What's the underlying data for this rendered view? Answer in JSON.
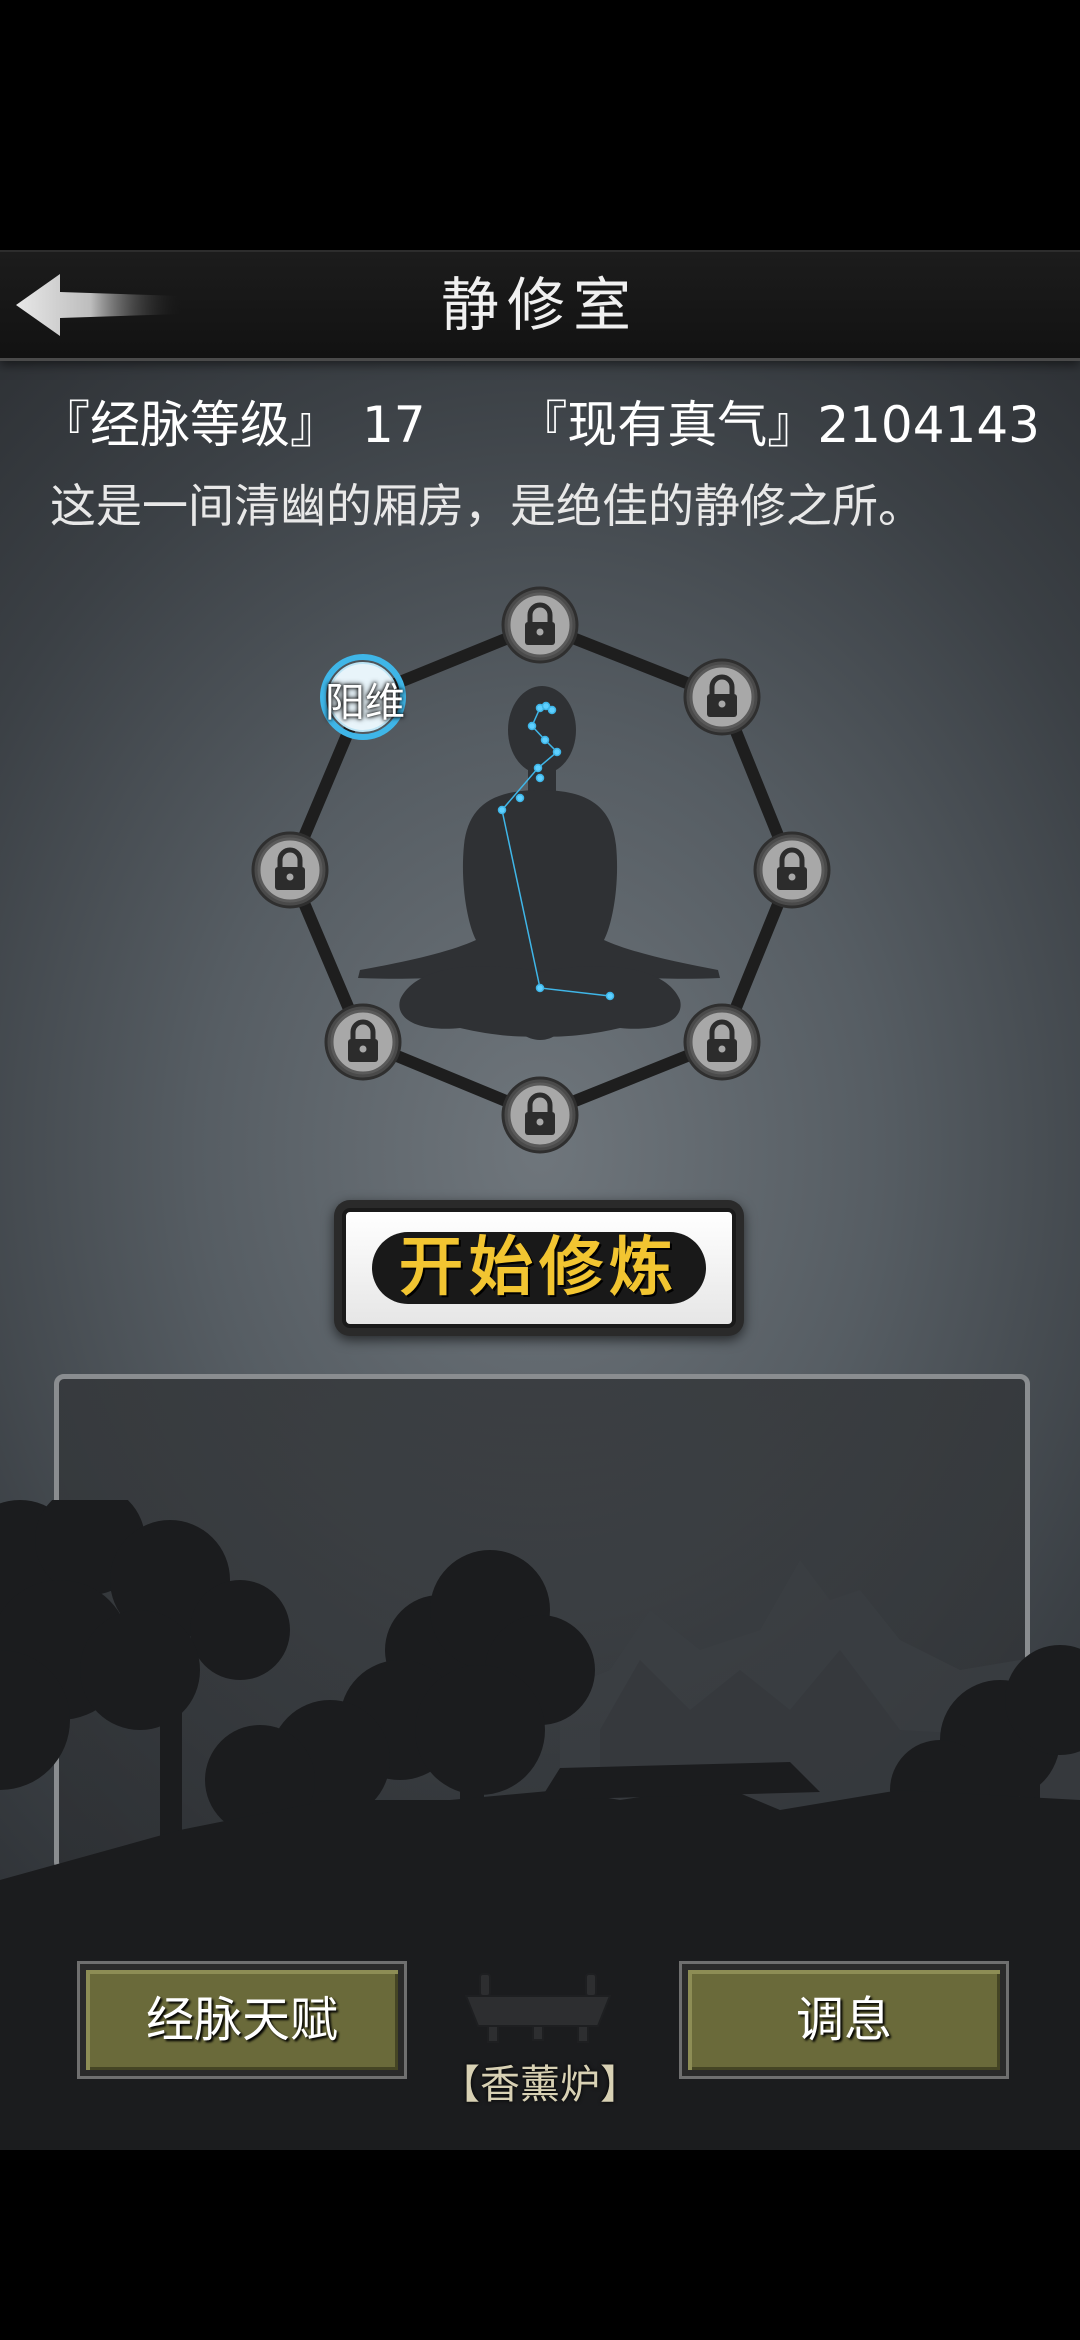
{
  "header": {
    "title": "静修室",
    "back_icon": "back-arrow-icon"
  },
  "stats": {
    "meridian_level_label": "『经脉等级』",
    "meridian_level_value": "17",
    "qi_label": "『现有真气』",
    "qi_value": "2104143"
  },
  "description": "这是一间清幽的厢房，是绝佳的静修之所。",
  "meridian_nodes": [
    {
      "label": "阳维",
      "state": "unlocked"
    },
    {
      "label": "",
      "state": "locked"
    },
    {
      "label": "",
      "state": "locked"
    },
    {
      "label": "",
      "state": "locked"
    },
    {
      "label": "",
      "state": "locked"
    },
    {
      "label": "",
      "state": "locked"
    },
    {
      "label": "",
      "state": "locked"
    },
    {
      "label": "",
      "state": "locked"
    }
  ],
  "start_button": {
    "label": "开始修炼"
  },
  "footer": {
    "talent_button": "经脉天赋",
    "incense_label": "【香薰炉】",
    "rest_button": "调息"
  },
  "colors": {
    "accent_blue": "#3fb6e8",
    "gold_text": "#f2c531",
    "olive_button": "#6a6a3a"
  }
}
